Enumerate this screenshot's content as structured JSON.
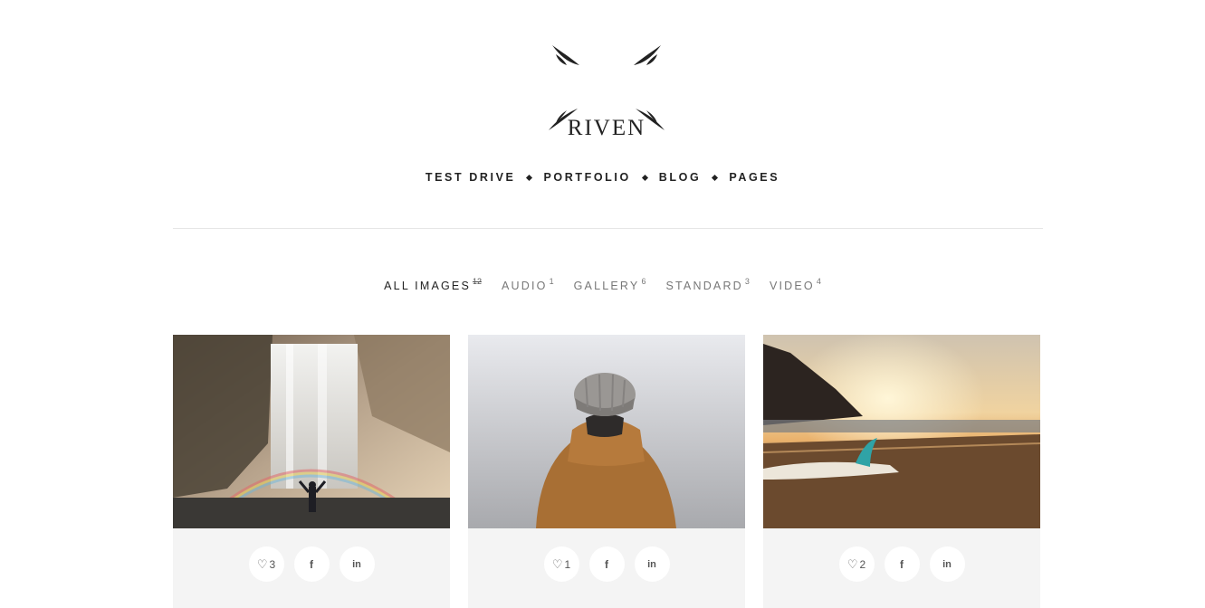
{
  "logo": {
    "text": "RIVEN"
  },
  "nav": {
    "items": [
      "TEST DRIVE",
      "PORTFOLIO",
      "BLOG",
      "PAGES"
    ]
  },
  "filters": [
    {
      "label": "ALL IMAGES",
      "count": "12",
      "active": true
    },
    {
      "label": "AUDIO",
      "count": "1",
      "active": false
    },
    {
      "label": "GALLERY",
      "count": "6",
      "active": false
    },
    {
      "label": "STANDARD",
      "count": "3",
      "active": false
    },
    {
      "label": "VIDEO",
      "count": "4",
      "active": false
    }
  ],
  "cards": [
    {
      "likes": "3",
      "facebook_label": "f",
      "linkedin_label": "in"
    },
    {
      "likes": "1",
      "facebook_label": "f",
      "linkedin_label": "in"
    },
    {
      "likes": "2",
      "facebook_label": "f",
      "linkedin_label": "in"
    }
  ],
  "colors": {
    "text": "#222222",
    "muted": "#777777",
    "card_background": "#f4f4f4",
    "divider": "#e6e6e6"
  },
  "icons": {
    "like": "heart-icon",
    "facebook": "facebook-icon",
    "linkedin": "linkedin-icon"
  }
}
